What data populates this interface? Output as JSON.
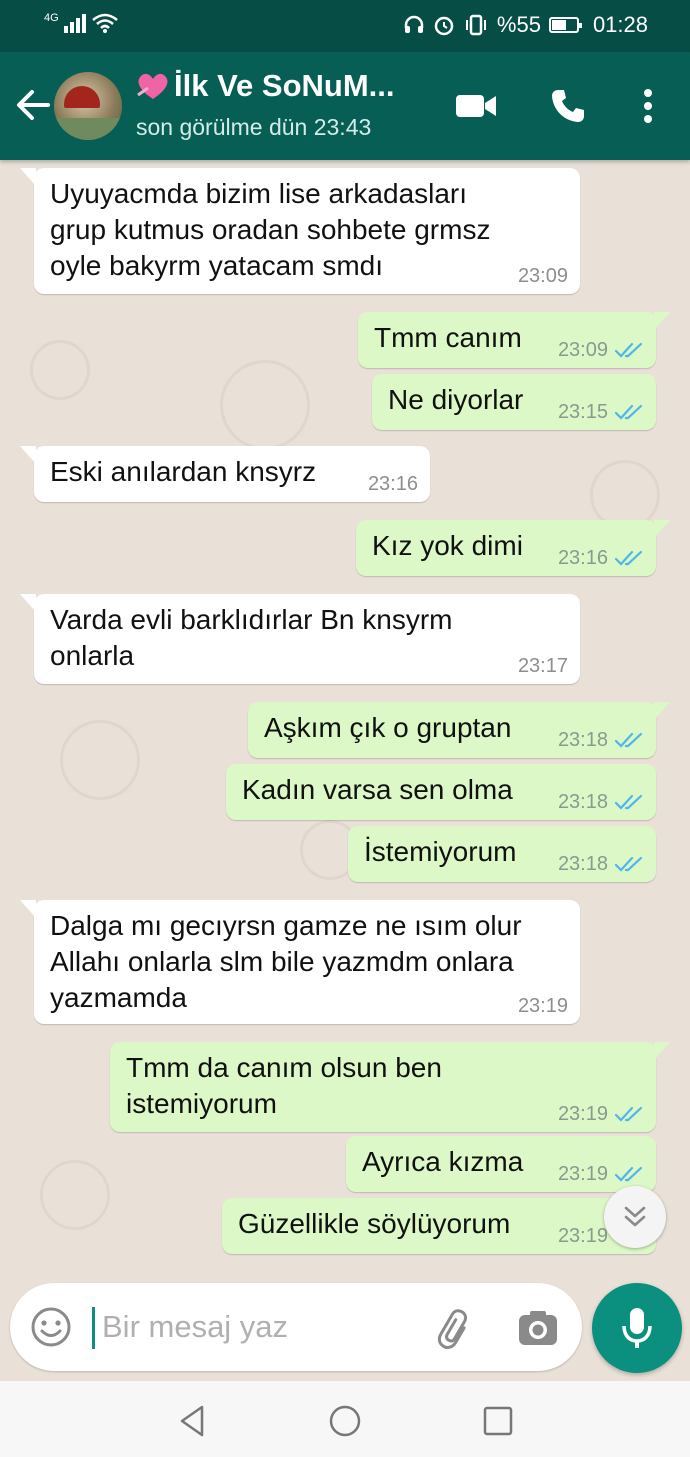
{
  "status_bar": {
    "network": "4G",
    "battery_percent": "%55",
    "time": "01:28",
    "icons": [
      "signal-icon",
      "wifi-icon",
      "headset-icon",
      "alarm-icon",
      "vibrate-icon",
      "battery-icon"
    ]
  },
  "header": {
    "contact_name": "İlk Ve SoNuM...",
    "last_seen": "son görülme dün 23:43",
    "icons": [
      "back-arrow-icon",
      "avatar",
      "video-call-icon",
      "phone-icon",
      "more-options-icon"
    ]
  },
  "messages": [
    {
      "dir": "in",
      "text": "Uyuyacmda bizim lise arkadasları\ngrup kutmus oradan sohbete grmsz\noyle bakyrm yatacam smdı",
      "time": "23:09"
    },
    {
      "dir": "out",
      "text": "Tmm canım",
      "time": "23:09"
    },
    {
      "dir": "out",
      "text": "Ne diyorlar",
      "time": "23:15"
    },
    {
      "dir": "in",
      "text": "Eski anılardan knsyrz",
      "time": "23:16"
    },
    {
      "dir": "out",
      "text": "Kız yok dimi",
      "time": "23:16"
    },
    {
      "dir": "in",
      "text": "Varda evli barklıdırlar Bn knsyrm\nonlarla",
      "time": "23:17"
    },
    {
      "dir": "out",
      "text": "Aşkım çık o gruptan",
      "time": "23:18"
    },
    {
      "dir": "out",
      "text": "Kadın varsa sen olma",
      "time": "23:18"
    },
    {
      "dir": "out",
      "text": "İstemiyorum",
      "time": "23:18"
    },
    {
      "dir": "in",
      "text": "Dalga mı gecıyrsn gamze ne ısım olur\nAllahı onlarla slm bile yazmdm onlara\nyazmamda",
      "time": "23:19"
    },
    {
      "dir": "out",
      "text": "Tmm da canım olsun ben\nistemiyorum",
      "time": "23:19"
    },
    {
      "dir": "out",
      "text": "Ayrıca kızma",
      "time": "23:19"
    },
    {
      "dir": "out",
      "text": "Güzellikle söylüyorum",
      "time": "23:19"
    }
  ],
  "composer": {
    "placeholder": "Bir mesaj yaz",
    "icons": [
      "emoji-icon",
      "attach-icon",
      "camera-icon",
      "mic-icon"
    ]
  },
  "colors": {
    "status_bar": "#064d46",
    "app_bar": "#075e54",
    "incoming_bubble": "#ffffff",
    "outgoing_bubble": "#dcf8c6",
    "read_ticks": "#4fb6ec",
    "mic_button": "#0b8f7e"
  }
}
